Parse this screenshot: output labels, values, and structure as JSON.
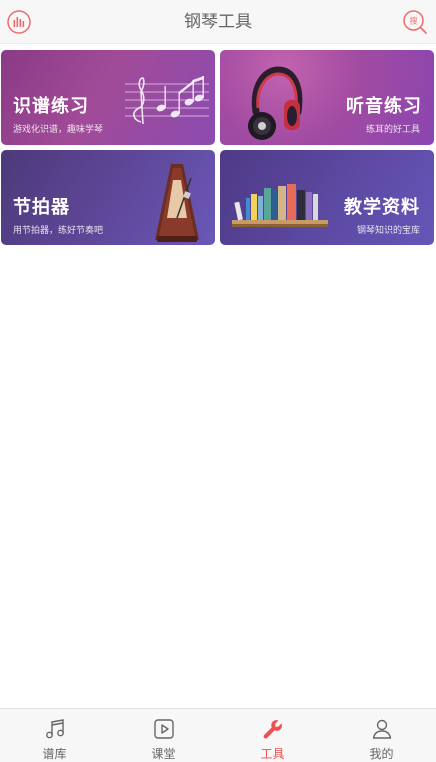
{
  "header": {
    "title": "钢琴工具",
    "left_icon": "equalizer-icon",
    "right_icon": "search-icon",
    "right_icon_text": "搜"
  },
  "cards": [
    {
      "title": "识谱练习",
      "subtitle": "游戏化识谱，趣味学琴",
      "icon": "music-notes-icon"
    },
    {
      "title": "听音练习",
      "subtitle": "练耳的好工具",
      "icon": "headphones-icon"
    },
    {
      "title": "节拍器",
      "subtitle": "用节拍器，练好节奏吧",
      "icon": "metronome-icon"
    },
    {
      "title": "教学资料",
      "subtitle": "钢琴知识的宝库",
      "icon": "bookshelf-icon"
    }
  ],
  "tabs": [
    {
      "label": "谱库",
      "icon": "music-note-icon",
      "active": false
    },
    {
      "label": "课堂",
      "icon": "play-icon",
      "active": false
    },
    {
      "label": "工具",
      "icon": "wrench-icon",
      "active": true
    },
    {
      "label": "我的",
      "icon": "user-icon",
      "active": false
    }
  ],
  "colors": {
    "accent": "#ef4f4f",
    "tab_inactive": "#666666",
    "header_bg": "#f7f7f7"
  }
}
